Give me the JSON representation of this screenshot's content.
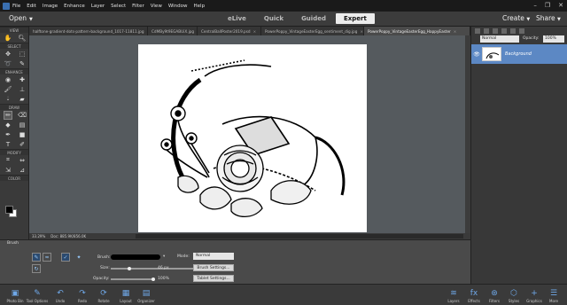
{
  "menubar": {
    "items": [
      "File",
      "Edit",
      "Image",
      "Enhance",
      "Layer",
      "Select",
      "Filter",
      "View",
      "Window",
      "Help"
    ],
    "window_controls": [
      "–",
      "❐",
      "✕"
    ]
  },
  "modebar": {
    "open_label": "Open",
    "modes": [
      {
        "label": "eLive",
        "active": false
      },
      {
        "label": "Quick",
        "active": false
      },
      {
        "label": "Guided",
        "active": false
      },
      {
        "label": "Expert",
        "active": true
      }
    ],
    "create_label": "Create",
    "share_label": "Share"
  },
  "tabs": [
    {
      "label": "halftone-gradient-dots-pattern-background_1017-11811.jpg",
      "active": false
    },
    {
      "label": "CdMBy9t9EGABUiX.jpg",
      "active": false
    },
    {
      "label": "CentralBallPoster2019.psd",
      "active": false
    },
    {
      "label": "PowerPoppy_VintageEasterEgg_sentiment_dig.jpg",
      "active": false
    },
    {
      "label": "PowerPoppy_VintageEasterEgg_HappyEaster",
      "active": true
    }
  ],
  "toolbox": {
    "sections": {
      "view": "VIEW",
      "select": "SELECT",
      "enhance": "ENHANCE",
      "draw": "DRAW",
      "modify": "MODIFY",
      "color": "COLOR"
    },
    "colors": {
      "foreground": "#000000",
      "background": "#ffffff"
    }
  },
  "status": {
    "zoom": "33.29%",
    "doc": "Doc: 885.9K/856.0K"
  },
  "layers": {
    "blend_mode": "Normal",
    "opacity_label": "Opacity:",
    "opacity_value": "100%",
    "items": [
      {
        "name": "Background",
        "visible": true
      }
    ]
  },
  "tool_options": {
    "title": "Brush",
    "brush_label": "Brush:",
    "size_label": "Size:",
    "size_value": "46 px",
    "size_fraction": 0.18,
    "opacity_label": "Opacity:",
    "opacity_value": "100%",
    "opacity_fraction": 1.0,
    "mode_label": "Mode:",
    "mode_value": "Normal",
    "brush_settings": "Brush Settings...",
    "tablet_settings": "Tablet Settings..."
  },
  "bottombar": {
    "left": [
      "Photo Bin",
      "Tool Options",
      "Undo",
      "Redo",
      "Rotate",
      "Layout",
      "Organizer"
    ],
    "right": [
      "Layers",
      "Effects",
      "Filters",
      "Styles",
      "Graphics",
      "More"
    ]
  },
  "colors": {
    "accent": "#5c88c4",
    "active_tab": "#ececec"
  }
}
